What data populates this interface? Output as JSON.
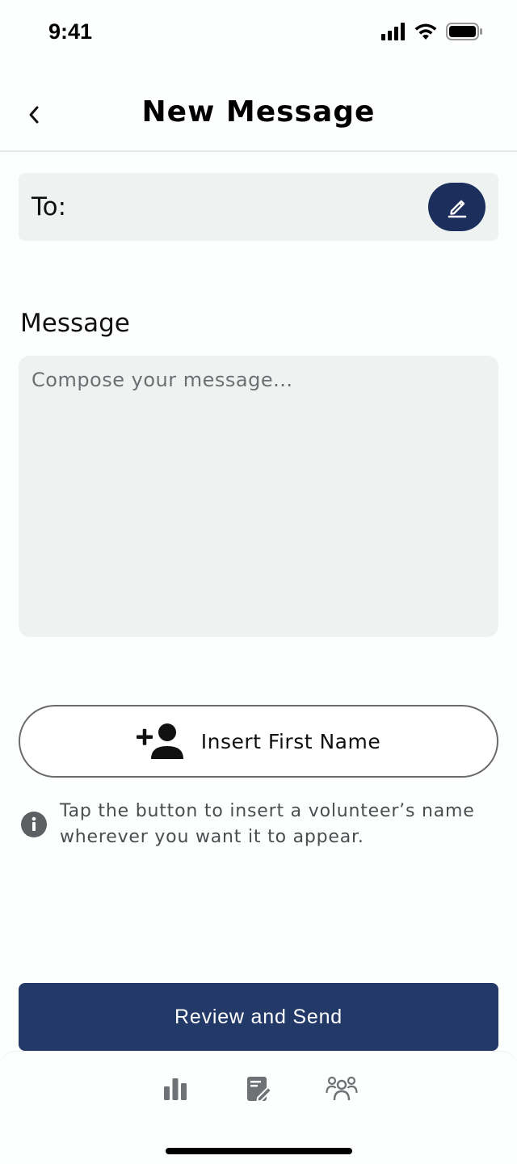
{
  "status_bar": {
    "time": "9:41",
    "icons": [
      "signal-icon",
      "wifi-icon",
      "battery-icon"
    ]
  },
  "header": {
    "title": "New Message",
    "back_icon": "chevron-left-icon"
  },
  "recipients": {
    "label": "To:",
    "edit_icon": "pencil-icon"
  },
  "message": {
    "label": "Message",
    "placeholder": "Compose your message...",
    "value": ""
  },
  "insert_name": {
    "label": "Insert First Name",
    "icon": "add-person-icon"
  },
  "info": {
    "icon": "info-icon",
    "text": "Tap the button to insert a volunteer’s name wherever you want it to appear."
  },
  "actions": {
    "send_label": "Review and Send"
  },
  "tab_bar": {
    "tabs": [
      {
        "icon": "bar-chart-icon"
      },
      {
        "icon": "compose-icon"
      },
      {
        "icon": "people-icon"
      }
    ]
  },
  "colors": {
    "primary": "#233a69",
    "edit_button": "#1c2f5c",
    "field_background": "#eef3f2",
    "tab_icon": "#6e7275"
  }
}
